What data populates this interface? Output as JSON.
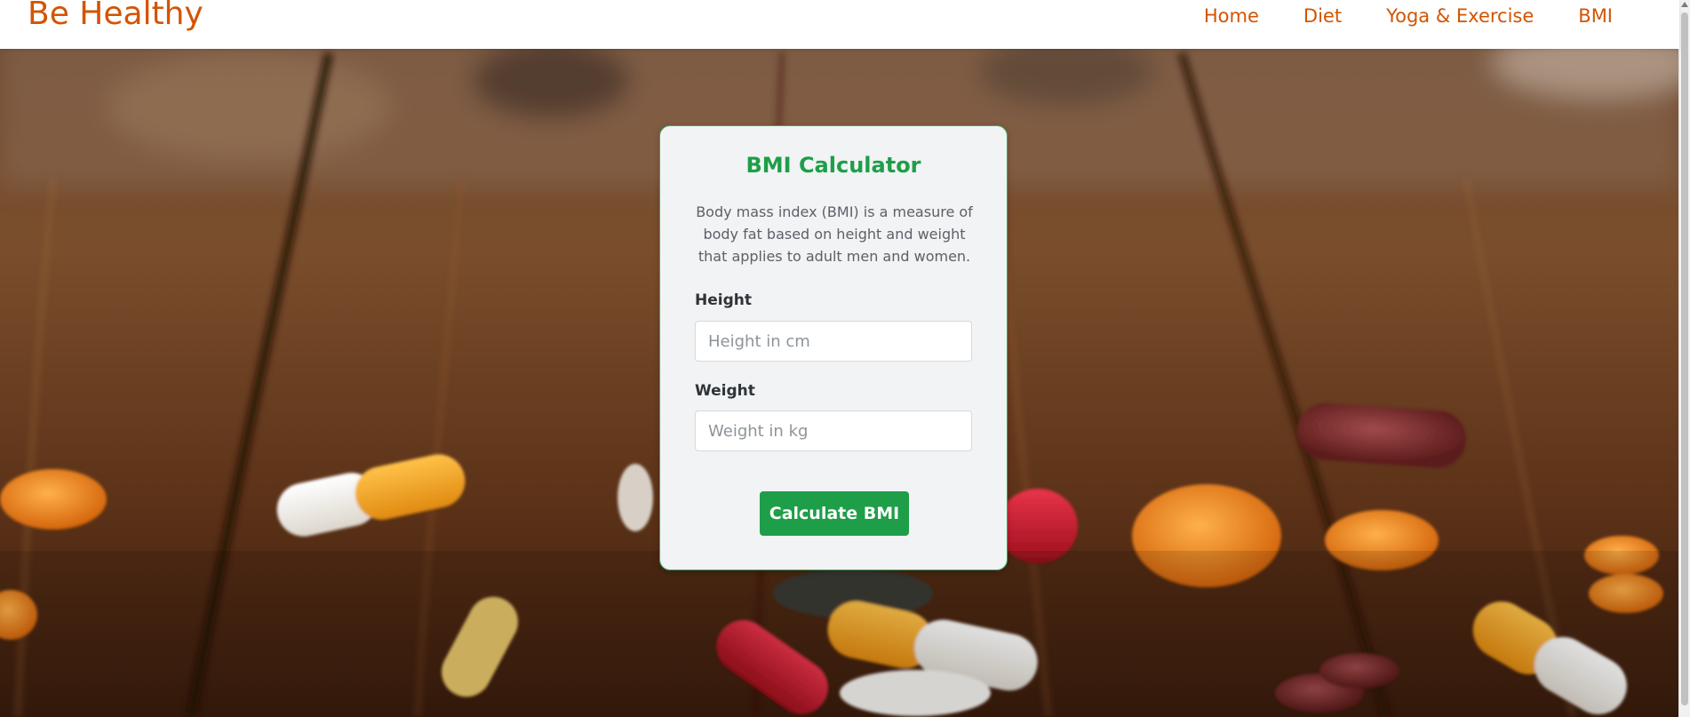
{
  "nav": {
    "brand": "Be Healthy",
    "links": [
      {
        "label": "Home"
      },
      {
        "label": "Diet"
      },
      {
        "label": "Yoga & Exercise"
      },
      {
        "label": "BMI"
      }
    ],
    "accent_color": "#d35400"
  },
  "card": {
    "title": "BMI Calculator",
    "description": "Body mass index (BMI) is a measure of body fat based on height and weight that applies to adult men and women.",
    "height_label": "Height",
    "height_placeholder": "Height in cm",
    "height_value": "",
    "weight_label": "Weight",
    "weight_placeholder": "Weight in kg",
    "weight_value": "",
    "button_label": "Calculate BMI",
    "accent_color": "#1e9e48"
  }
}
